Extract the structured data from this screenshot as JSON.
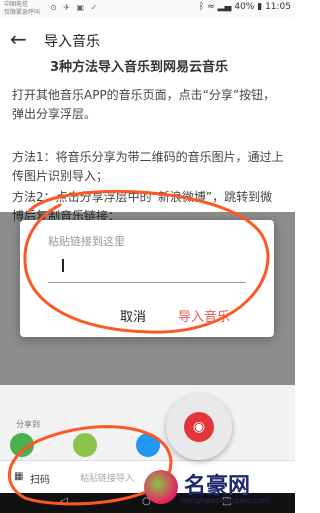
{
  "status_bar": {
    "carrier_line1": "中国电信",
    "carrier_line2": "仅限紧急呼叫",
    "battery": "40%",
    "time": "11:05"
  },
  "app_bar": {
    "back_icon": "arrow-left-icon",
    "title": "导入音乐"
  },
  "content": {
    "subtitle": "3种方法导入音乐到网易云音乐",
    "paragraph1": "打开其他音乐APP的音乐页面，点击“分享”按钮，弹出分享浮层。",
    "paragraph2": "方法1：将音乐分享为带二维码的音乐图片，通过上传图片识别导入；",
    "paragraph3": "方法2：点击分享浮层中的“新浪微博”，跳转到微博后复制音乐链接："
  },
  "dialog": {
    "placeholder": "粘贴链接到这里",
    "input_value": "",
    "cancel_label": "取消",
    "import_label": "导入音乐",
    "accent_color": "#e65a50"
  },
  "share_sheet": {
    "label": "分享到",
    "scan_label": "扫码",
    "paste_hint": "粘贴链接导入"
  },
  "watermark": {
    "name": "名豪网",
    "url": "minghaoshangwu.com"
  },
  "annotation_color": "#ff5722"
}
